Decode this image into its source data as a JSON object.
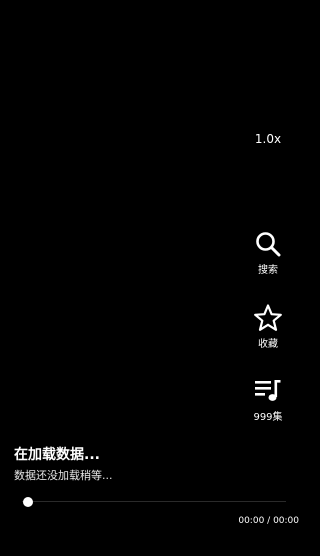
{
  "player": {
    "speed_label": "1.0x",
    "progress": 0,
    "current_time": "00:00",
    "time_separator": " / ",
    "total_time": "00:00"
  },
  "side_actions": {
    "search": {
      "label": "搜索",
      "icon": "search-icon"
    },
    "favorite": {
      "label": "收藏",
      "icon": "star-icon"
    },
    "episodes": {
      "label": "999集",
      "icon": "playlist-icon"
    }
  },
  "status": {
    "title": "在加载数据...",
    "subtitle": "数据还没加载稍等..."
  },
  "colors": {
    "background": "#000000",
    "foreground": "#ffffff",
    "track": "#2a2a2a"
  }
}
